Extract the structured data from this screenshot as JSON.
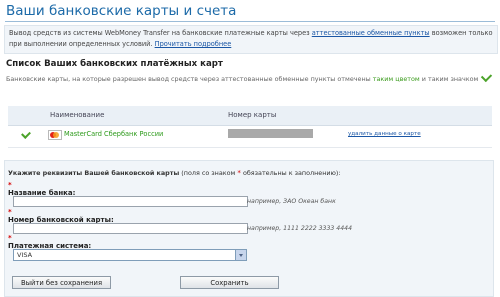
{
  "page": {
    "title": "Ваши банковские карты и счета"
  },
  "info": {
    "text_before": "Вывод средств из системы WebMoney Transfer на банковские платежные карты через ",
    "link1": "аттестованные обменные пункты",
    "text_middle": " возможен только при выполнении определенных условий. ",
    "link2": "Прочитать подробнее"
  },
  "cards_section": {
    "heading": "Список Ваших банковских платёжных карт",
    "desc_before": "Банковские карты, на которые разрешен вывод средств через аттестованные обменные пункты отмечены ",
    "desc_green": "таким цветом",
    "desc_after": " и таким значком",
    "icon_legend": "check-icon"
  },
  "table": {
    "columns": [
      "Наименование",
      "Номер карты"
    ],
    "rows": [
      {
        "icon": "mastercard-icon",
        "name": "MasterCard Сбербанк России",
        "number_masked": true,
        "action": "удалить данные о карте"
      }
    ]
  },
  "form": {
    "intro_bold": "Укажите реквизиты Вашей банковской карты",
    "intro_normal": " (поля со знаком ",
    "intro_star": "*",
    "intro_end": " обязательны к заполнению):",
    "bank_name_label": "Название банка:",
    "bank_name_value": "",
    "bank_name_hint": "например, ЗАО Океан банк",
    "card_number_label": "Номер банковской карты:",
    "card_number_value": "",
    "card_number_hint": "например, 1111 2222 3333 4444",
    "payment_system_label": "Платежная система:",
    "payment_system_value": "VISA",
    "required_mark": "*",
    "exit_button": "Выйти без сохранения",
    "save_button": "Сохранить"
  },
  "colors": {
    "title_blue": "#1c6aa8",
    "link_blue": "#1a56a5",
    "allowed_green": "#3a9b1c",
    "panel_bg": "#f1f5f9"
  }
}
